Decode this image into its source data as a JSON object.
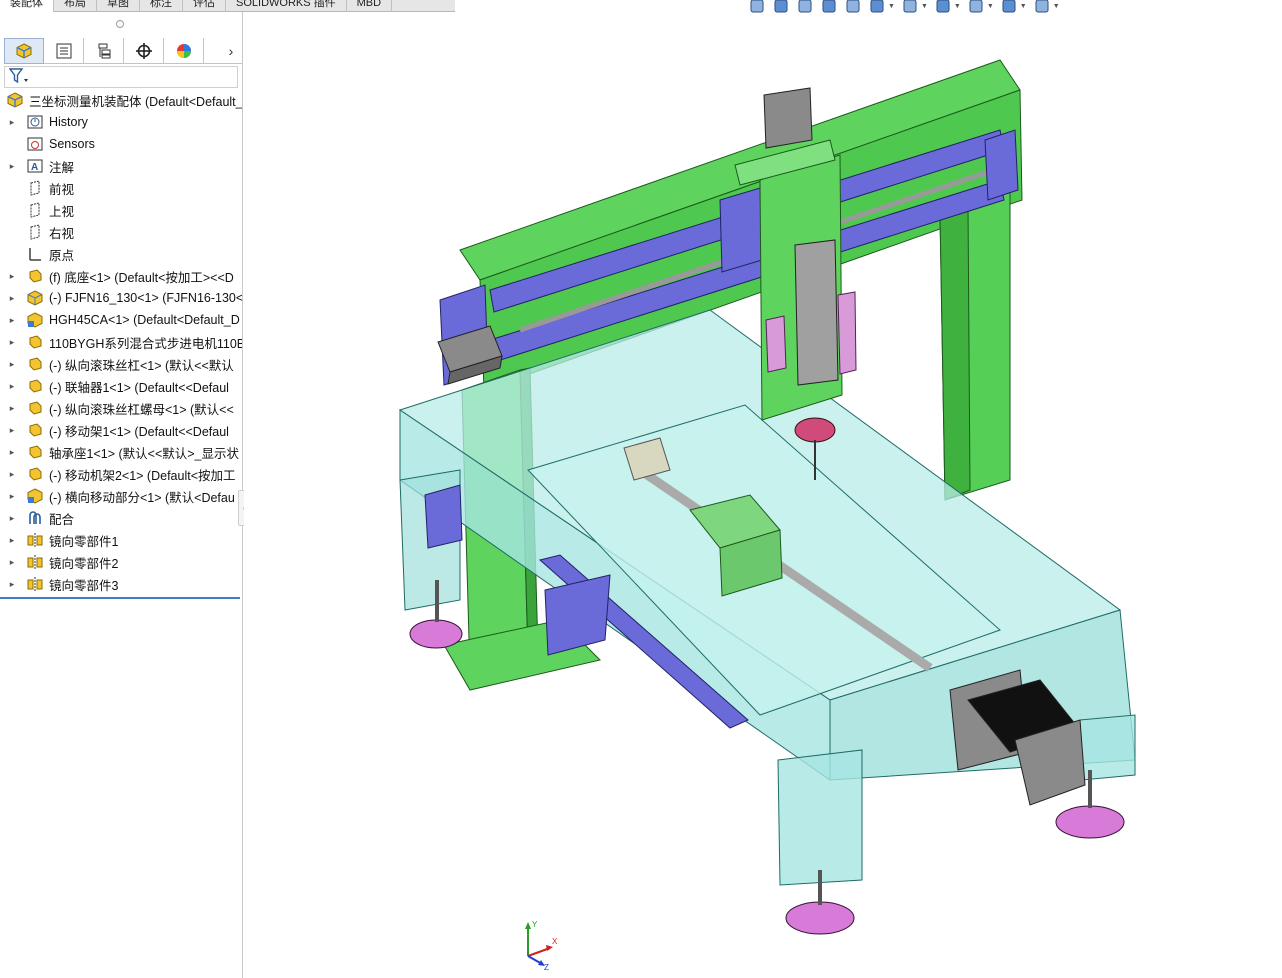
{
  "command_tabs": [
    "装配体",
    "布局",
    "草图",
    "标注",
    "评估",
    "SOLIDWORKS 插件",
    "MBD"
  ],
  "feature_tree": {
    "root": {
      "label": "三坐标测量机装配体  (Default<Default_",
      "icon": "assembly-icon"
    },
    "items": [
      {
        "label": "History",
        "icon": "history-icon",
        "expandable": true
      },
      {
        "label": "Sensors",
        "icon": "sensors-icon",
        "expandable": false
      },
      {
        "label": "注解",
        "icon": "annotations-icon",
        "expandable": true
      },
      {
        "label": "前视",
        "icon": "plane-icon",
        "expandable": false
      },
      {
        "label": "上视",
        "icon": "plane-icon",
        "expandable": false
      },
      {
        "label": "右视",
        "icon": "plane-icon",
        "expandable": false
      },
      {
        "label": "原点",
        "icon": "origin-icon",
        "expandable": false
      },
      {
        "label": "(f) 底座<1> (Default<按加工><<D",
        "icon": "part-icon",
        "expandable": true
      },
      {
        "label": "(-) FJFN16_130<1> (FJFN16-130<",
        "icon": "subassembly-icon",
        "expandable": true
      },
      {
        "label": "HGH45CA<1> (Default<Default_D",
        "icon": "subassembly-edit-icon",
        "expandable": true
      },
      {
        "label": "110BYGH系列混合式步进电机110B",
        "icon": "part-icon",
        "expandable": true
      },
      {
        "label": "(-) 纵向滚珠丝杠<1> (默认<<默认",
        "icon": "part-icon",
        "expandable": true
      },
      {
        "label": "(-) 联轴器1<1> (Default<<Defaul",
        "icon": "part-icon",
        "expandable": true
      },
      {
        "label": "(-) 纵向滚珠丝杠螺母<1> (默认<<",
        "icon": "part-icon",
        "expandable": true
      },
      {
        "label": "(-) 移动架1<1> (Default<<Defaul",
        "icon": "part-icon",
        "expandable": true
      },
      {
        "label": "轴承座1<1> (默认<<默认>_显示状",
        "icon": "part-icon",
        "expandable": true
      },
      {
        "label": "(-) 移动机架2<1> (Default<按加工",
        "icon": "part-icon",
        "expandable": true
      },
      {
        "label": "(-) 横向移动部分<1> (默认<Defau",
        "icon": "subassembly-edit-icon",
        "expandable": true
      },
      {
        "label": "配合",
        "icon": "mates-icon",
        "expandable": true
      },
      {
        "label": "镜向零部件1",
        "icon": "mirror-component-icon",
        "expandable": true
      },
      {
        "label": "镜向零部件2",
        "icon": "mirror-component-icon",
        "expandable": true
      },
      {
        "label": "镜向零部件3",
        "icon": "mirror-component-icon",
        "expandable": true
      }
    ]
  },
  "pane_tabs": [
    "feature-manager-icon",
    "property-manager-icon",
    "configuration-manager-icon",
    "dimxpert-icon",
    "display-manager-icon"
  ],
  "hud_icons": [
    "zoom-to-fit-icon",
    "zoom-area-icon",
    "previous-view-icon",
    "section-view-icon",
    "dynamic-annotation-icon",
    "view-orientation-icon",
    "display-style-icon",
    "hide-show-icon",
    "edit-appearance-icon",
    "scene-icon",
    "view-settings-icon"
  ],
  "triad": {
    "x": "X",
    "y": "Y",
    "z": "Z"
  },
  "colors": {
    "frame_green": "#5ed45e",
    "rail_blue": "#6a6ad8",
    "glass": "#a6e6e2",
    "pad_magenta": "#d87ad8",
    "motor_gray": "#8a8a8a",
    "selection_blue": "#3b7ec4"
  }
}
